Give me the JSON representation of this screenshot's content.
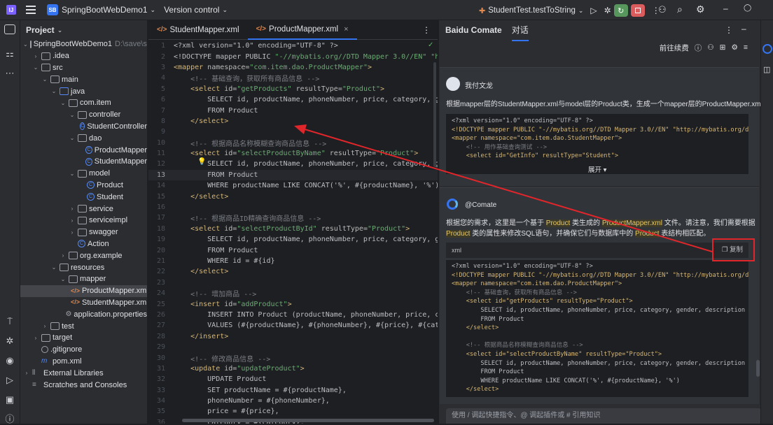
{
  "titlebar": {
    "project_badge": "SB",
    "project_name": "SpringBootWebDemo1",
    "vcs": "Version control",
    "run_config": "StudentTest.testToString"
  },
  "project_panel": {
    "title": "Project",
    "tree": [
      {
        "label": "SpringBootWebDemo1",
        "extra": "D:\\save\\stu",
        "depth": 0,
        "arrow": "v",
        "icon": "folder"
      },
      {
        "label": ".idea",
        "depth": 1,
        "arrow": ">",
        "icon": "folder"
      },
      {
        "label": "src",
        "depth": 1,
        "arrow": "v",
        "icon": "folder"
      },
      {
        "label": "main",
        "depth": 2,
        "arrow": "v",
        "icon": "folder"
      },
      {
        "label": "java",
        "depth": 3,
        "arrow": "v",
        "icon": "folder-blue"
      },
      {
        "label": "com.item",
        "depth": 4,
        "arrow": "v",
        "icon": "pkg"
      },
      {
        "label": "controller",
        "depth": 5,
        "arrow": "v",
        "icon": "pkg"
      },
      {
        "label": "StudentController",
        "depth": 6,
        "arrow": "",
        "icon": "cls"
      },
      {
        "label": "dao",
        "depth": 5,
        "arrow": "v",
        "icon": "pkg"
      },
      {
        "label": "ProductMapper",
        "depth": 6,
        "arrow": "",
        "icon": "cls"
      },
      {
        "label": "StudentMapper",
        "depth": 6,
        "arrow": "",
        "icon": "cls"
      },
      {
        "label": "model",
        "depth": 5,
        "arrow": "v",
        "icon": "pkg"
      },
      {
        "label": "Product",
        "depth": 6,
        "arrow": "",
        "icon": "cls"
      },
      {
        "label": "Student",
        "depth": 6,
        "arrow": "",
        "icon": "cls"
      },
      {
        "label": "service",
        "depth": 5,
        "arrow": ">",
        "icon": "pkg"
      },
      {
        "label": "serviceimpl",
        "depth": 5,
        "arrow": ">",
        "icon": "pkg"
      },
      {
        "label": "swagger",
        "depth": 5,
        "arrow": ">",
        "icon": "pkg"
      },
      {
        "label": "Action",
        "depth": 5,
        "arrow": "",
        "icon": "cls"
      },
      {
        "label": "org.example",
        "depth": 4,
        "arrow": ">",
        "icon": "pkg"
      },
      {
        "label": "resources",
        "depth": 3,
        "arrow": "v",
        "icon": "folder"
      },
      {
        "label": "mapper",
        "depth": 4,
        "arrow": "v",
        "icon": "folder"
      },
      {
        "label": "ProductMapper.xml",
        "depth": 5,
        "arrow": "",
        "icon": "xml",
        "selected": true
      },
      {
        "label": "StudentMapper.xml",
        "depth": 5,
        "arrow": "",
        "icon": "xml"
      },
      {
        "label": "application.properties",
        "depth": 4,
        "arrow": "",
        "icon": "props"
      },
      {
        "label": "test",
        "depth": 2,
        "arrow": ">",
        "icon": "folder"
      },
      {
        "label": "target",
        "depth": 1,
        "arrow": ">",
        "icon": "folder"
      },
      {
        "label": ".gitignore",
        "depth": 1,
        "arrow": "",
        "icon": "git"
      },
      {
        "label": "pom.xml",
        "depth": 1,
        "arrow": "",
        "icon": "m"
      },
      {
        "label": "External Libraries",
        "depth": 0,
        "arrow": ">",
        "icon": "lib"
      },
      {
        "label": "Scratches and Consoles",
        "depth": 0,
        "arrow": "",
        "icon": "scratch"
      }
    ]
  },
  "editor": {
    "tabs": [
      {
        "label": "StudentMapper.xml",
        "active": false
      },
      {
        "label": "ProductMapper.xml",
        "active": true
      }
    ],
    "lines": [
      {
        "n": "1",
        "parts": [
          [
            "ct",
            "<?xml version=\"1.0\" encoding=\"UTF-8\" ?>"
          ]
        ]
      },
      {
        "n": "2",
        "parts": [
          [
            "ct",
            "<!DOCTYPE mapper PUBLIC "
          ],
          [
            "t-str",
            "\"-//mybatis.org//DTD Mapper 3.0//EN\" \"htt"
          ]
        ]
      },
      {
        "n": "3",
        "parts": [
          [
            "t-tag",
            "<mapper "
          ],
          [
            "t-attr",
            "namespace="
          ],
          [
            "t-str",
            "\"com.item.dao.ProductMapper\""
          ],
          [
            "t-tag",
            ">"
          ]
        ]
      },
      {
        "n": "4",
        "parts": [
          [
            "t-com",
            "    <!-- 基础查询，获取所有商品信息 -->"
          ]
        ]
      },
      {
        "n": "5",
        "parts": [
          [
            "t-tag",
            "    <select "
          ],
          [
            "t-attr",
            "id="
          ],
          [
            "t-str",
            "\"getProducts\" "
          ],
          [
            "t-attr",
            "resultType="
          ],
          [
            "t-str",
            "\"Product\""
          ],
          [
            "t-tag",
            ">"
          ]
        ]
      },
      {
        "n": "6",
        "parts": [
          [
            "ct",
            "        SELECT id, productName, phoneNumber, price, category, gend"
          ]
        ]
      },
      {
        "n": "7",
        "parts": [
          [
            "ct",
            "        FROM Product"
          ]
        ]
      },
      {
        "n": "8",
        "parts": [
          [
            "t-tag",
            "    </select>"
          ]
        ]
      },
      {
        "n": "9",
        "parts": [
          [
            "ct",
            ""
          ]
        ]
      },
      {
        "n": "10",
        "parts": [
          [
            "t-com",
            "    <!-- 根据商品名称模糊查询商品信息 -->"
          ]
        ]
      },
      {
        "n": "11",
        "parts": [
          [
            "t-tag",
            "    <select "
          ],
          [
            "t-attr",
            "id="
          ],
          [
            "t-str",
            "\"selectProductByName\" "
          ],
          [
            "t-attr",
            "resultType="
          ],
          [
            "t-str",
            "\"Product\""
          ],
          [
            "t-tag",
            ">"
          ]
        ]
      },
      {
        "n": "12",
        "parts": [
          [
            "ct",
            "        SELECT id, productName, phoneNumber, price, category, gend"
          ]
        ]
      },
      {
        "n": "13",
        "parts": [
          [
            "ct",
            "        FROM Product"
          ]
        ],
        "current": true
      },
      {
        "n": "14",
        "parts": [
          [
            "ct",
            "        WHERE productName LIKE CONCAT('%', #{productName}, '%')"
          ]
        ]
      },
      {
        "n": "15",
        "parts": [
          [
            "t-tag",
            "    </select>"
          ]
        ]
      },
      {
        "n": "16",
        "parts": [
          [
            "ct",
            ""
          ]
        ]
      },
      {
        "n": "17",
        "parts": [
          [
            "t-com",
            "    <!-- 根据商品ID精确查询商品信息 -->"
          ]
        ]
      },
      {
        "n": "18",
        "parts": [
          [
            "t-tag",
            "    <select "
          ],
          [
            "t-attr",
            "id="
          ],
          [
            "t-str",
            "\"selectProductById\" "
          ],
          [
            "t-attr",
            "resultType="
          ],
          [
            "t-str",
            "\"Product\""
          ],
          [
            "t-tag",
            ">"
          ]
        ]
      },
      {
        "n": "19",
        "parts": [
          [
            "ct",
            "        SELECT id, productName, phoneNumber, price, category, gend"
          ]
        ]
      },
      {
        "n": "20",
        "parts": [
          [
            "ct",
            "        FROM Product"
          ]
        ]
      },
      {
        "n": "21",
        "parts": [
          [
            "ct",
            "        WHERE id = #{id}"
          ]
        ]
      },
      {
        "n": "22",
        "parts": [
          [
            "t-tag",
            "    </select>"
          ]
        ]
      },
      {
        "n": "23",
        "parts": [
          [
            "ct",
            ""
          ]
        ]
      },
      {
        "n": "24",
        "parts": [
          [
            "t-com",
            "    <!-- 增加商品 -->"
          ]
        ]
      },
      {
        "n": "25",
        "parts": [
          [
            "t-tag",
            "    <insert "
          ],
          [
            "t-attr",
            "id="
          ],
          [
            "t-str",
            "\"addProduct\""
          ],
          [
            "t-tag",
            ">"
          ]
        ]
      },
      {
        "n": "26",
        "parts": [
          [
            "ct",
            "        INSERT INTO Product (productName, phoneNumber, price, cate"
          ]
        ]
      },
      {
        "n": "27",
        "parts": [
          [
            "ct",
            "        VALUES (#{productName}, #{phoneNumber}, #{price}, #{catego"
          ]
        ]
      },
      {
        "n": "28",
        "parts": [
          [
            "t-tag",
            "    </insert>"
          ]
        ]
      },
      {
        "n": "29",
        "parts": [
          [
            "ct",
            ""
          ]
        ]
      },
      {
        "n": "30",
        "parts": [
          [
            "t-com",
            "    <!-- 修改商品信息 -->"
          ]
        ]
      },
      {
        "n": "31",
        "parts": [
          [
            "t-tag",
            "    <update "
          ],
          [
            "t-attr",
            "id="
          ],
          [
            "t-str",
            "\"updateProduct\""
          ],
          [
            "t-tag",
            ">"
          ]
        ]
      },
      {
        "n": "32",
        "parts": [
          [
            "ct",
            "        UPDATE Product"
          ]
        ]
      },
      {
        "n": "33",
        "parts": [
          [
            "ct",
            "        SET productName = #{productName},"
          ]
        ]
      },
      {
        "n": "34",
        "parts": [
          [
            "ct",
            "        phoneNumber = #{phoneNumber},"
          ]
        ]
      },
      {
        "n": "35",
        "parts": [
          [
            "ct",
            "        price = #{price},"
          ]
        ]
      },
      {
        "n": "36",
        "parts": [
          [
            "ct",
            "        category = #{category},"
          ]
        ]
      }
    ]
  },
  "chat": {
    "title": "Baidu Comate",
    "tab": "对话",
    "toolbar_link": "前往续费",
    "user_name": "我付文龙",
    "user_message": "根据mapper层的StudentMapper.xml与model层的Product类，生成一个mapper层的ProductMapper.xml。",
    "user_code": [
      "<?xml version=\"1.0\" encoding=\"UTF-8\" ?>",
      "<!DOCTYPE mapper PUBLIC \"-//mybatis.org//DTD Mapper 3.0//EN\" \"http://mybatis.org/dtd/mybatis",
      "<mapper namespace=\"com.item.dao.StudentMapper\">",
      "    <!-- 用作基础查询测试 -->",
      "    <select id=\"GetInfo\" resultType=\"Student\">"
    ],
    "expand_label": "展开",
    "bot_name": "@Comate",
    "bot_line1_a": "根据您的需求，这里是一个基于 ",
    "bot_hl1": "Product",
    "bot_line1_b": " 类生成的 ",
    "bot_hl2": "ProductMapper.xml",
    "bot_line1_c": " 文件。请注意，我们需要根据",
    "bot_hl3": "Product",
    "bot_line2_a": " 类的属性来修改SQL语句，并确保它们与数据库中的 ",
    "bot_hl4": "Product",
    "bot_line2_b": " 表结构相匹配。",
    "code_lang": "xml",
    "copy_label": "复制",
    "bot_code": [
      "<?xml version=\"1.0\" encoding=\"UTF-8\" ?>",
      "<!DOCTYPE mapper PUBLIC \"-//mybatis.org//DTD Mapper 3.0//EN\" \"http://mybatis.org/dtd/mybatis",
      "<mapper namespace=\"com.item.dao.ProductMapper\">",
      "    <!-- 基础查询，获取所有商品信息 -->",
      "    <select id=\"getProducts\" resultType=\"Product\">",
      "        SELECT id, productName, phoneNumber, price, category, gender, description",
      "        FROM Product",
      "    </select>",
      "",
      "    <!-- 根据商品名称模糊查询商品信息 -->",
      "    <select id=\"selectProductByName\" resultType=\"Product\">",
      "        SELECT id, productName, phoneNumber, price, category, gender, description",
      "        FROM Product",
      "        WHERE productName LIKE CONCAT('%', #{productName}, '%')",
      "    </select>"
    ],
    "input_placeholder": "使用 / 调起快捷指令、@ 调起插件或 # 引用知识"
  }
}
